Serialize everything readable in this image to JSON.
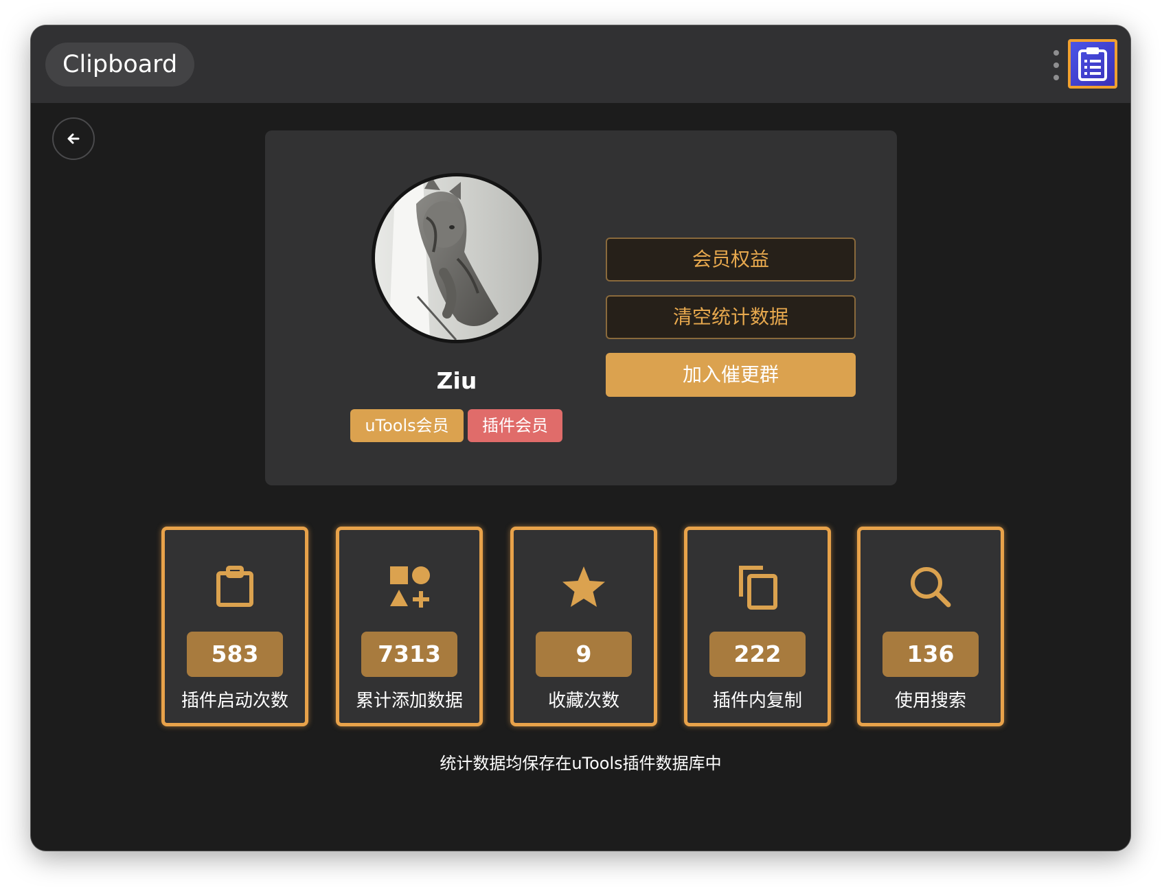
{
  "app": {
    "title": "Clipboard",
    "accent_color": "#dba24f",
    "menu_icon": "more-vert-icon",
    "plugin_logo_icon": "clipboard-list-icon"
  },
  "back": {
    "icon": "arrow-left-icon"
  },
  "profile": {
    "avatar": "cat-photo",
    "username": "Ziu",
    "tags": [
      {
        "label": "uTools会员",
        "color": "#dba24f"
      },
      {
        "label": "插件会员",
        "color": "#e06c6a"
      }
    ]
  },
  "actions": {
    "member_benefits": "会员权益",
    "clear_stats": "清空统计数据",
    "join_group": "加入催更群"
  },
  "stats": [
    {
      "icon": "clipboard-icon",
      "value": "583",
      "label": "插件启动次数"
    },
    {
      "icon": "shapes-icon",
      "value": "7313",
      "label": "累计添加数据"
    },
    {
      "icon": "star-icon",
      "value": "9",
      "label": "收藏次数"
    },
    {
      "icon": "copy-icon",
      "value": "222",
      "label": "插件内复制"
    },
    {
      "icon": "search-icon",
      "value": "136",
      "label": "使用搜索"
    }
  ],
  "footer": {
    "note": "统计数据均保存在uTools插件数据库中"
  }
}
